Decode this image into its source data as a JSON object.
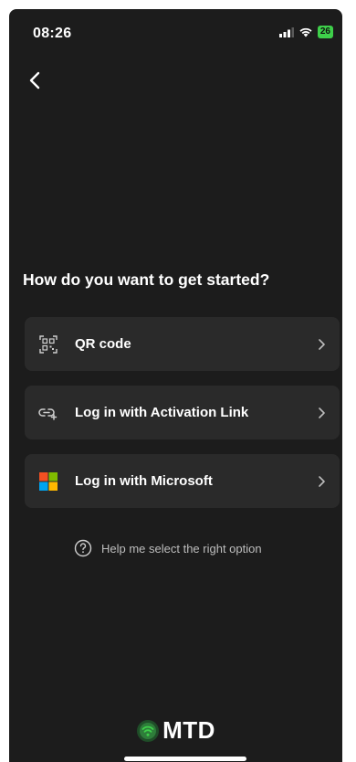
{
  "status_bar": {
    "time": "08:26",
    "battery": "26"
  },
  "heading": "How do you want to get started?",
  "options": [
    {
      "label": "QR code",
      "icon": "qr-code-icon"
    },
    {
      "label": "Log in with Activation Link",
      "icon": "link-icon"
    },
    {
      "label": "Log in with Microsoft",
      "icon": "microsoft-logo-icon"
    }
  ],
  "help_text": "Help me select the right option",
  "brand": {
    "name": "MTD",
    "accent": "#3ecf4a"
  },
  "colors": {
    "background": "#1c1c1c",
    "card": "#2a2a2a",
    "microsoft_red": "#f25022",
    "microsoft_green": "#7fba00",
    "microsoft_blue": "#00a4ef",
    "microsoft_yellow": "#ffb900"
  }
}
